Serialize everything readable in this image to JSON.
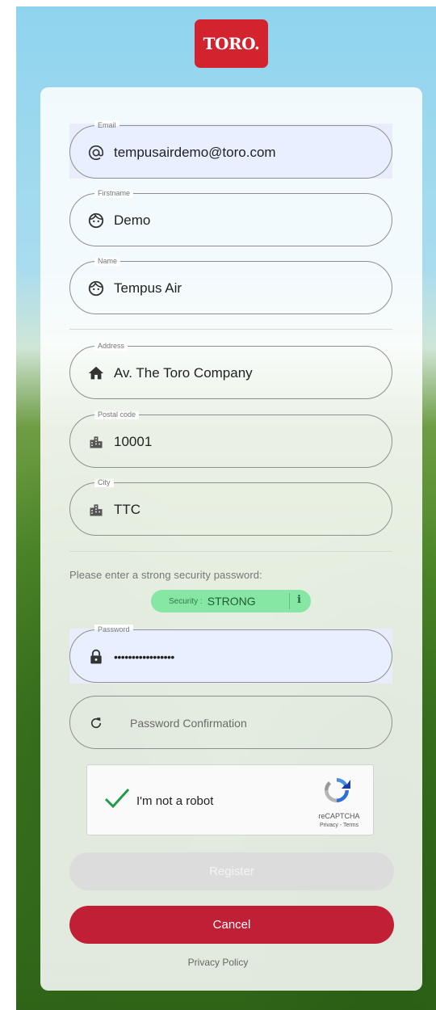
{
  "brand": {
    "logo_text": "TORO."
  },
  "fields": {
    "email": {
      "label": "Email",
      "value": "tempusairdemo@toro.com",
      "icon": "at-icon"
    },
    "firstname": {
      "label": "Firstname",
      "value": "Demo",
      "icon": "face-icon"
    },
    "name": {
      "label": "Name",
      "value": "Tempus Air",
      "icon": "face-icon"
    },
    "address": {
      "label": "Address",
      "value": "Av. The Toro Company",
      "icon": "home-icon"
    },
    "postal_code": {
      "label": "Postal code",
      "value": "10001",
      "icon": "building-icon"
    },
    "city": {
      "label": "City",
      "value": "TTC",
      "icon": "building-icon"
    },
    "password": {
      "label": "Password",
      "value": "•••••••••••••••••",
      "icon": "lock-icon"
    },
    "password_confirmation": {
      "placeholder": "Password Confirmation",
      "icon": "refresh-icon"
    }
  },
  "password_hint": "Please enter a strong security password:",
  "strength": {
    "label": "Security :",
    "value": "STRONG",
    "info": "i",
    "color": "#86e7a5"
  },
  "captcha": {
    "text": "I'm not a robot",
    "brand": "reCAPTCHA",
    "links": "Privacy - Terms"
  },
  "buttons": {
    "register": "Register",
    "cancel": "Cancel"
  },
  "footer": {
    "privacy": "Privacy Policy"
  },
  "colors": {
    "accent": "#c11f35",
    "logo": "#d3232e",
    "filled_field": "#e8efff"
  }
}
